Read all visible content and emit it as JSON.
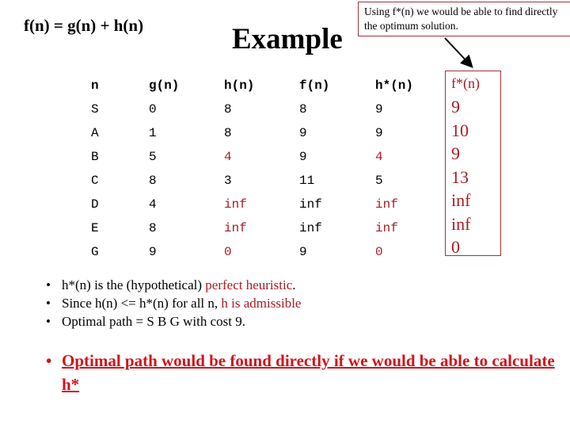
{
  "formula": "f(n) = g(n) + h(n)",
  "title": "Example",
  "callout": "Using f*(n) we would be able to find directly the optimum solution.",
  "colors": {
    "accent_red": "#a81c24",
    "highlight_red": "#d0141c",
    "box_border": "#a0343a"
  },
  "table": {
    "columns": [
      {
        "header": "n",
        "values": [
          "S",
          "A",
          "B",
          "C",
          "D",
          "E",
          "G"
        ],
        "red": []
      },
      {
        "header": "g(n)",
        "values": [
          "0",
          "1",
          "5",
          "8",
          "4",
          "8",
          "9"
        ],
        "red": []
      },
      {
        "header": "h(n)",
        "values": [
          "8",
          "8",
          "4",
          "3",
          "inf",
          "inf",
          "0"
        ],
        "red": [
          2,
          4,
          5,
          6
        ]
      },
      {
        "header": "f(n)",
        "values": [
          "8",
          "9",
          "9",
          "11",
          "inf",
          "inf",
          "9"
        ],
        "red": []
      },
      {
        "header": "h*(n)",
        "values": [
          "9",
          "9",
          "4",
          "5",
          "inf",
          "inf",
          "0"
        ],
        "red": [
          2,
          4,
          5,
          6
        ]
      }
    ],
    "fstar": {
      "header": "f*(n)",
      "values": [
        "9",
        "10",
        "9",
        "13",
        "inf",
        "inf",
        "0"
      ]
    }
  },
  "bullets": [
    {
      "text": "h*(n) is the (hypothetical) ",
      "highlight": "perfect heuristic",
      "suffix": "."
    },
    {
      "text": "Since h(n) <= h*(n) for all n, ",
      "highlight": "h is admissible",
      "suffix": ""
    },
    {
      "text": "Optimal path = S B G with cost 9.",
      "highlight": "",
      "suffix": ""
    }
  ],
  "conclusion": "Optimal path would be found directly if we would be able to calculate h*"
}
